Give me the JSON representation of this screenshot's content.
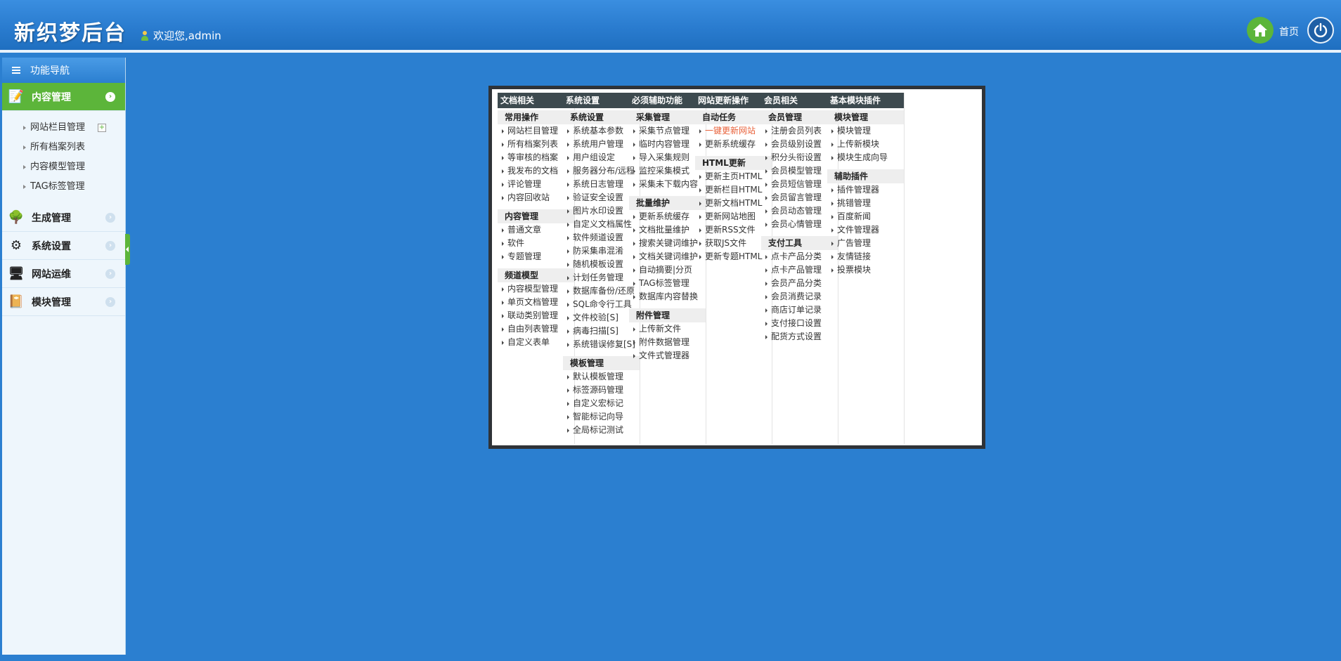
{
  "header": {
    "logo": "新织梦后台",
    "welcome": "欢迎您,admin",
    "home_label": "首页",
    "accent": "#2b7fd0",
    "home_color": "#5cb53a"
  },
  "sidebar": {
    "title": "功能导航",
    "menus": [
      {
        "label": "内容管理",
        "icon": "notepad-icon",
        "active": true,
        "items": [
          "网站栏目管理",
          "所有档案列表",
          "内容模型管理",
          "TAG标签管理"
        ]
      },
      {
        "label": "生成管理",
        "icon": "tree-icon"
      },
      {
        "label": "系统设置",
        "icon": "gears-icon"
      },
      {
        "label": "网站运维",
        "icon": "monitor-icon"
      },
      {
        "label": "模块管理",
        "icon": "book-icon"
      }
    ]
  },
  "columns": [
    {
      "title": "文档相关",
      "groups": [
        {
          "title": "常用操作",
          "links": [
            "网站栏目管理",
            "所有档案列表",
            "等审核的档案",
            "我发布的文档",
            "评论管理",
            "内容回收站"
          ]
        },
        {
          "title": "内容管理",
          "links": [
            "普通文章",
            "软件",
            "专题管理"
          ]
        },
        {
          "title": "频道模型",
          "links": [
            "内容模型管理",
            "单页文档管理",
            "联动类别管理",
            "自由列表管理",
            "自定义表单"
          ]
        }
      ]
    },
    {
      "title": "系统设置",
      "groups": [
        {
          "title": "系统设置",
          "links": [
            "系统基本参数",
            "系统用户管理",
            "用户组设定",
            "服务器分布/远程",
            "系统日志管理",
            "验证安全设置",
            "图片水印设置",
            "自定义文档属性",
            "软件频道设置",
            "防采集串混淆",
            "随机模板设置",
            "计划任务管理",
            "数据库备份/还原",
            "SQL命令行工具",
            "文件校验[S]",
            "病毒扫描[S]",
            "系统错误修复[S]"
          ]
        },
        {
          "title": "模板管理",
          "links": [
            "默认模板管理",
            "标签源码管理",
            "自定义宏标记",
            "智能标记向导",
            "全局标记测试"
          ]
        }
      ]
    },
    {
      "title": "必须辅助功能",
      "groups": [
        {
          "title": "采集管理",
          "links": [
            "采集节点管理",
            "临时内容管理",
            "导入采集规则",
            "监控采集模式",
            "采集未下载内容"
          ]
        },
        {
          "title": "批量维护",
          "links": [
            "更新系统缓存",
            "文档批量维护",
            "搜索关键词维护",
            "文档关键词维护",
            "自动摘要|分页",
            "TAG标签管理",
            "数据库内容替换"
          ]
        },
        {
          "title": "附件管理",
          "links": [
            "上传新文件",
            "附件数据管理",
            "文件式管理器"
          ]
        }
      ]
    },
    {
      "title": "网站更新操作",
      "groups": [
        {
          "title": "自动任务",
          "links": [
            "一键更新网站",
            "更新系统缓存"
          ],
          "hot": [
            0
          ]
        },
        {
          "title": "HTML更新",
          "links": [
            "更新主页HTML",
            "更新栏目HTML",
            "更新文档HTML",
            "更新网站地图",
            "更新RSS文件",
            "获取JS文件",
            "更新专题HTML"
          ]
        }
      ]
    },
    {
      "title": "会员相关",
      "groups": [
        {
          "title": "会员管理",
          "links": [
            "注册会员列表",
            "会员级别设置",
            "积分头衔设置",
            "会员模型管理",
            "会员短信管理",
            "会员留言管理",
            "会员动态管理",
            "会员心情管理"
          ]
        },
        {
          "title": "支付工具",
          "links": [
            "点卡产品分类",
            "点卡产品管理",
            "会员产品分类",
            "会员消费记录",
            "商店订单记录",
            "支付接口设置",
            "配货方式设置"
          ]
        }
      ]
    },
    {
      "title": "基本模块插件",
      "groups": [
        {
          "title": "模块管理",
          "links": [
            "模块管理",
            "上传新模块",
            "模块生成向导"
          ]
        },
        {
          "title": "辅助插件",
          "links": [
            "插件管理器",
            "挑错管理",
            "百度新闻",
            "文件管理器",
            "广告管理",
            "友情链接",
            "投票模块"
          ]
        }
      ]
    }
  ]
}
